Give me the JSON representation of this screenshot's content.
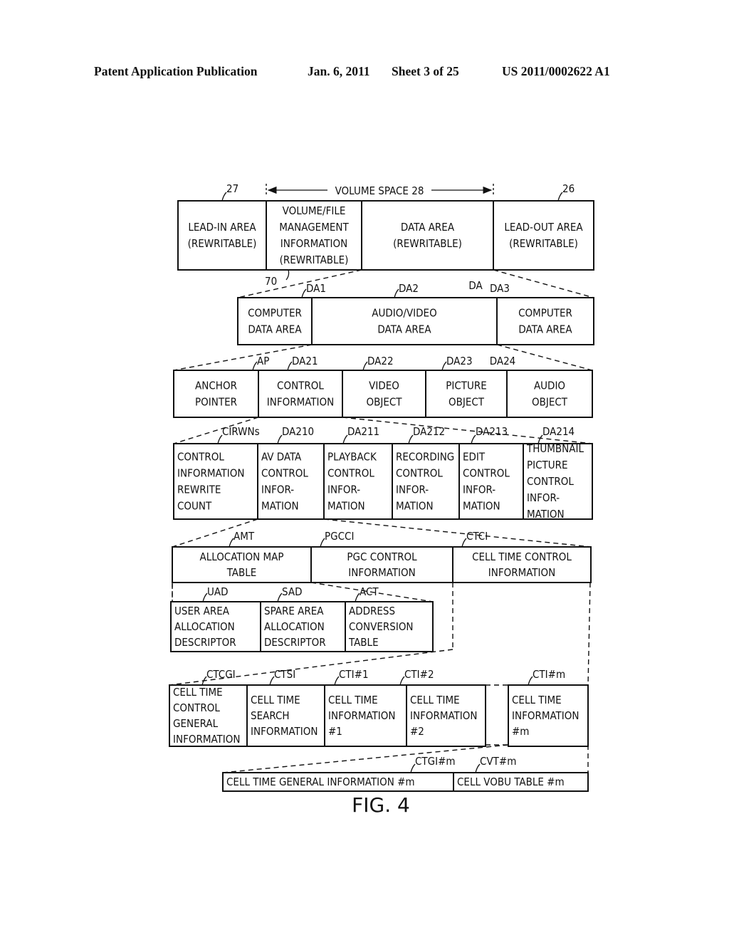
{
  "header": {
    "publication": "Patent Application Publication",
    "date": "Jan. 6, 2011",
    "sheet": "Sheet 3 of 25",
    "number": "US 2011/0002622 A1"
  },
  "figure_label": "FIG. 4",
  "volume_space_label": "VOLUME SPACE 28",
  "rows": [
    {
      "id": "disc-layout",
      "boxes": [
        {
          "ref": "27",
          "lines": [
            "LEAD-IN AREA",
            "(REWRITABLE)"
          ]
        },
        {
          "ref": "70",
          "lines": [
            "VOLUME/FILE",
            "MANAGEMENT",
            "INFORMATION",
            "(REWRITABLE)"
          ]
        },
        {
          "ref": "DA",
          "lines": [
            "DATA AREA",
            "(REWRITABLE)"
          ]
        },
        {
          "ref": "26",
          "lines": [
            "LEAD-OUT AREA",
            "(REWRITABLE)"
          ]
        }
      ]
    },
    {
      "id": "data-area",
      "boxes": [
        {
          "ref": "DA1",
          "lines": [
            "COMPUTER",
            "DATA AREA"
          ]
        },
        {
          "ref": "DA2",
          "lines": [
            "AUDIO/VIDEO",
            "DATA AREA"
          ]
        },
        {
          "ref": "DA3",
          "lines": [
            "COMPUTER",
            "DATA AREA"
          ]
        }
      ]
    },
    {
      "id": "av-data-area",
      "boxes": [
        {
          "ref": "AP",
          "lines": [
            "ANCHOR",
            "POINTER"
          ]
        },
        {
          "ref": "DA21",
          "lines": [
            "CONTROL",
            "INFORMATION"
          ]
        },
        {
          "ref": "DA22",
          "lines": [
            "VIDEO",
            "OBJECT"
          ]
        },
        {
          "ref": "DA23",
          "lines": [
            "PICTURE",
            "OBJECT"
          ]
        },
        {
          "ref": "DA24",
          "lines": [
            "AUDIO",
            "OBJECT"
          ]
        }
      ]
    },
    {
      "id": "control-information",
      "boxes": [
        {
          "ref": "CIRWNs",
          "lines": [
            "CONTROL",
            "INFORMATION",
            "REWRITE",
            "COUNT"
          ]
        },
        {
          "ref": "DA210",
          "lines": [
            "AV DATA",
            "CONTROL",
            "INFOR-",
            "MATION"
          ]
        },
        {
          "ref": "DA211",
          "lines": [
            "PLAYBACK",
            "CONTROL",
            "INFOR-",
            "MATION"
          ]
        },
        {
          "ref": "DA212",
          "lines": [
            "RECORDING",
            "CONTROL",
            "INFOR-",
            "MATION"
          ]
        },
        {
          "ref": "DA213",
          "lines": [
            "EDIT",
            "CONTROL",
            "INFOR-",
            "MATION"
          ]
        },
        {
          "ref": "DA214",
          "lines": [
            "THUMBNAIL",
            "PICTURE",
            "CONTROL",
            "INFOR-",
            "MATION"
          ]
        }
      ]
    },
    {
      "id": "av-data-control",
      "boxes": [
        {
          "ref": "AMT",
          "lines": [
            "ALLOCATION MAP",
            "TABLE"
          ]
        },
        {
          "ref": "PGCCI",
          "lines": [
            "PGC CONTROL",
            "INFORMATION"
          ]
        },
        {
          "ref": "CTCI",
          "lines": [
            "CELL TIME CONTROL",
            "INFORMATION"
          ]
        }
      ]
    },
    {
      "id": "allocation-map",
      "boxes": [
        {
          "ref": "UAD",
          "lines": [
            "USER AREA",
            "ALLOCATION",
            "DESCRIPTOR"
          ]
        },
        {
          "ref": "SAD",
          "lines": [
            "SPARE AREA",
            "ALLOCATION",
            "DESCRIPTOR"
          ]
        },
        {
          "ref": "ACT",
          "lines": [
            "ADDRESS",
            "CONVERSION",
            "TABLE"
          ]
        }
      ]
    },
    {
      "id": "cell-time-control",
      "boxes": [
        {
          "ref": "CTCGI",
          "lines": [
            "CELL TIME",
            "CONTROL",
            "GENERAL",
            "INFORMATION"
          ]
        },
        {
          "ref": "CTSI",
          "lines": [
            "CELL TIME",
            "SEARCH",
            "INFORMATION"
          ]
        },
        {
          "ref": "CTI#1",
          "lines": [
            "CELL TIME",
            "INFORMATION",
            "#1"
          ]
        },
        {
          "ref": "CTI#2",
          "lines": [
            "CELL TIME",
            "INFORMATION",
            "#2"
          ]
        },
        {
          "ref": "CTI#m",
          "lines": [
            "CELL TIME",
            "INFORMATION",
            "#m"
          ]
        }
      ]
    },
    {
      "id": "cell-time-information",
      "boxes": [
        {
          "ref": "CTGI#m",
          "lines": [
            "CELL TIME GENERAL INFORMATION #m"
          ]
        },
        {
          "ref": "CVT#m",
          "lines": [
            "CELL VOBU TABLE #m"
          ]
        }
      ]
    }
  ]
}
